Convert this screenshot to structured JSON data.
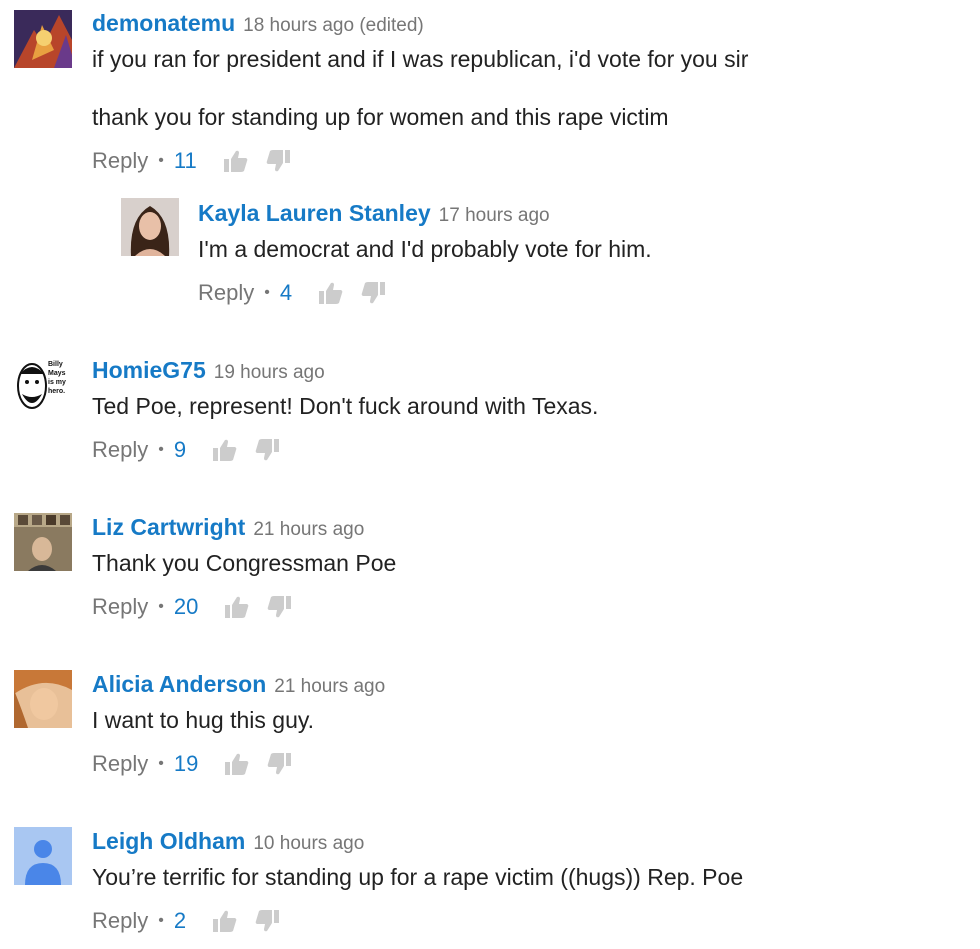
{
  "comments": [
    {
      "author": "demonatemu",
      "time": "18 hours ago (edited)",
      "lines": [
        "if you ran for president and if I was republican, i'd vote for you sir",
        "thank you for standing up for women and this rape victim"
      ],
      "reply": "Reply",
      "likes": "11",
      "avatar": "game-art-avatar",
      "replies": [
        {
          "author": "Kayla Lauren Stanley",
          "time": "17 hours ago",
          "lines": [
            "I'm a democrat and I'd probably vote for him."
          ],
          "reply": "Reply",
          "likes": "4",
          "avatar": "photo-avatar"
        }
      ]
    },
    {
      "author": "HomieG75",
      "time": "19 hours ago",
      "lines": [
        "Ted Poe, represent! Don't fuck around with Texas."
      ],
      "reply": "Reply",
      "likes": "9",
      "avatar": "billy-mays-avatar",
      "avatar_text": [
        "Billy",
        "Mays",
        "is my",
        "hero."
      ]
    },
    {
      "author": "Liz Cartwright",
      "time": "21 hours ago",
      "lines": [
        "Thank you Congressman Poe"
      ],
      "reply": "Reply",
      "likes": "20",
      "avatar": "photo-avatar"
    },
    {
      "author": "Alicia Anderson",
      "time": "21 hours ago",
      "lines": [
        "I want to hug this guy."
      ],
      "reply": "Reply",
      "likes": "19",
      "avatar": "photo-avatar"
    },
    {
      "author": "Leigh Oldham",
      "time": "10 hours ago",
      "lines": [
        "You’re terrific for standing up for a rape victim ((hugs)) Rep. Poe"
      ],
      "reply": "Reply",
      "likes": "2",
      "avatar": "default-user-avatar"
    }
  ],
  "colors": {
    "author": "#167ac6",
    "meta": "#767676",
    "thumb": "#cccccc",
    "default_avatar_bg": "#a9c7f2",
    "default_avatar_fg": "#4a86e8"
  }
}
